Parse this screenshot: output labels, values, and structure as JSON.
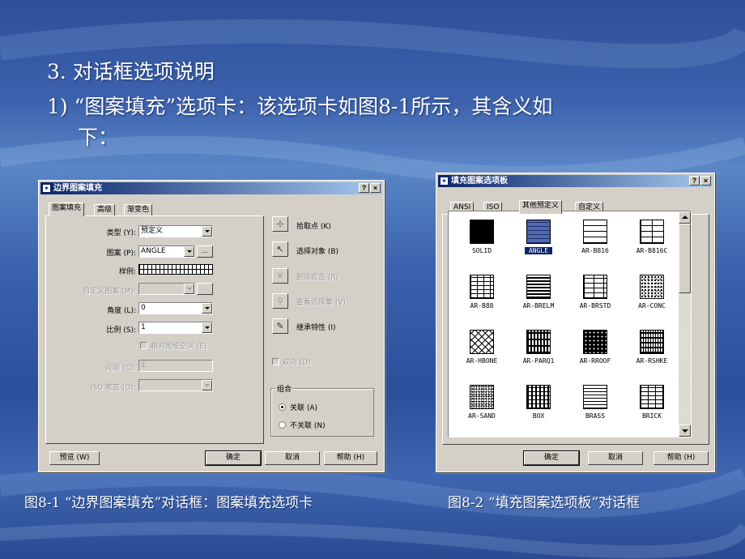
{
  "slide": {
    "heading_line1": "3. 对话框选项说明",
    "heading_line2": "1) “图案填充”选项卡：该选项卡如图8-1所示，其含义如",
    "heading_line3": "下：",
    "caption1": "图8-1 “边界图案填充”对话框：图案填充选项卡",
    "caption2": "图8-2 “填充图案选项板”对话框"
  },
  "dialog1": {
    "title": "边界图案填充",
    "help_btn": "?",
    "close_btn": "×",
    "tabs": [
      "图案填充",
      "高级",
      "渐变色"
    ],
    "labels": {
      "type": "类型 (Y):",
      "pattern": "图案 (P):",
      "swatch": "样例:",
      "custom": "自定义图案 (M):",
      "angle": "角度 (L):",
      "scale": "比例 (S):",
      "relative": "相对图纸空间 (E)",
      "spacing": "间距 (C):",
      "iso": "ISO 笔宽 (O):"
    },
    "values": {
      "type": "预定义",
      "pattern": "ANGLE",
      "angle": "0",
      "scale": "1",
      "spacing": "1"
    },
    "dots": "...",
    "actions": {
      "pick": "拾取点 (K)",
      "select": "选择对象 (B)",
      "remove": "删除孤岛 (R)",
      "view": "查看选择集 (V)",
      "inherit": "继承特性 (I)"
    },
    "double": "双向 (D)",
    "compose": {
      "label": "组合",
      "assoc": "关联 (A)",
      "nonassoc": "不关联 (N)"
    },
    "buttons": {
      "preview": "预览 (W)",
      "ok": "确定",
      "cancel": "取消",
      "help": "帮助 (H)"
    }
  },
  "dialog2": {
    "title": "填充图案选项板",
    "help_btn": "?",
    "close_btn": "×",
    "tabs": [
      "ANSI",
      "ISO",
      "其他预定义",
      "自定义"
    ],
    "patterns": [
      "SOLID",
      "ANGLE",
      "AR-B816",
      "AR-B816C",
      "AR-B88",
      "AR-BRELM",
      "AR-BRSTD",
      "AR-CONC",
      "AR-HBONE",
      "AR-PARQ1",
      "AR-RROOF",
      "AR-RSHKE",
      "AR-SAND",
      "BOX",
      "BRASS",
      "BRICK"
    ],
    "selected": "ANGLE",
    "buttons": {
      "ok": "确定",
      "cancel": "取消",
      "help": "帮助 (H)"
    }
  },
  "colors": {
    "titlebar_start": "#0a246a",
    "titlebar_end": "#a6caf0",
    "dialog_face": "#d4d0c8",
    "selection": "#0a246a"
  }
}
